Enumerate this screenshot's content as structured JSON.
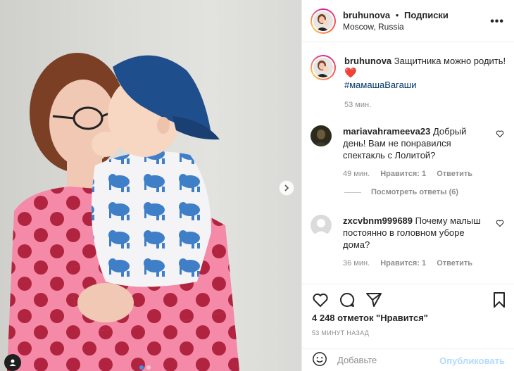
{
  "post": {
    "username": "bruhunova",
    "separator": "•",
    "follow_label": "Подписки",
    "location": "Moscow, Russia",
    "more_label": "•••"
  },
  "caption": {
    "username": "bruhunova",
    "text": "Защитника можно родить!",
    "emoji": "❤️",
    "hashtag": "#мамашаВагаши",
    "time": "53 мин."
  },
  "comments": [
    {
      "username": "mariavahrameeva23",
      "text": "Добрый день! Вам не понравился спектакль с Лолитой?",
      "time": "49 мин.",
      "likes": "Нравится: 1",
      "reply": "Ответить",
      "view_replies": "Посмотреть ответы (6)"
    },
    {
      "username": "zxcvbnm999689",
      "text": "Почему малыш постоянно в головном уборе дома?",
      "time": "36 мин.",
      "likes": "Нравится: 1",
      "reply": "Ответить"
    }
  ],
  "actions": {
    "likes_count": "4 248 отметок \"Нравится\"",
    "timestamp": "53 МИНУТ НАЗАД",
    "icons": [
      "heart-icon",
      "comment-icon",
      "share-icon",
      "bookmark-icon"
    ]
  },
  "add_comment": {
    "placeholder": "Добавьте",
    "publish_label": "Опубликовать"
  },
  "colors": {
    "link": "#003569",
    "meta": "#8e8e8e",
    "publish_disabled": "#b3dbff",
    "carousel_active": "#3897f0",
    "sweater_pink": "#f48aa8",
    "polka_dot": "#b0243f",
    "cap_blue": "#1f4e8c"
  }
}
